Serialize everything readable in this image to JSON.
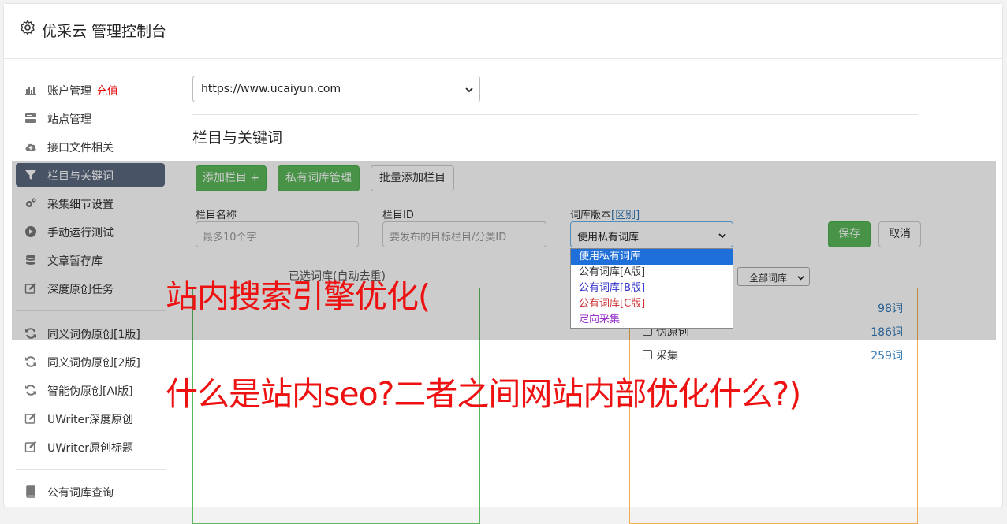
{
  "header": {
    "title": "优采云 管理控制台",
    "icon": "gear-icon"
  },
  "sidebar": {
    "items": [
      {
        "label": "账户管理",
        "badge": "充值",
        "icon": "bar-chart-icon"
      },
      {
        "label": "站点管理",
        "icon": "server-icon"
      },
      {
        "label": "接口文件相关",
        "icon": "cloud-upload-icon"
      },
      {
        "label": "栏目与关键词",
        "icon": "filter-icon",
        "active": true
      },
      {
        "label": "采集细节设置",
        "icon": "cogs-icon"
      },
      {
        "label": "手动运行测试",
        "icon": "play-circle-icon"
      },
      {
        "label": "文章暂存库",
        "icon": "database-icon"
      },
      {
        "label": "深度原创任务",
        "icon": "edit-icon"
      },
      {
        "label": "同义词伪原创[1版]",
        "icon": "refresh-icon"
      },
      {
        "label": "同义词伪原创[2版]",
        "icon": "refresh-icon"
      },
      {
        "label": "智能伪原创[AI版]",
        "icon": "refresh-icon"
      },
      {
        "label": "UWriter深度原创",
        "icon": "edit-icon"
      },
      {
        "label": "UWriter原创标题",
        "icon": "edit-icon"
      },
      {
        "label": "公有词库查询",
        "icon": "book-icon"
      }
    ]
  },
  "main": {
    "site_select": {
      "value": "https://www.ucaiyun.com"
    },
    "section_title": "栏目与关键词",
    "buttons": {
      "add_column": "添加栏目 +",
      "private_lib": "私有词库管理",
      "batch_add": "批量添加栏目",
      "save": "保存",
      "cancel": "取消"
    },
    "form": {
      "column_name_label": "栏目名称",
      "column_name_placeholder": "最多10个字",
      "column_id_label": "栏目ID",
      "column_id_placeholder": "要发布的目标栏目/分类ID",
      "lib_version_label": "词库版本",
      "lib_version_link": "[区别]",
      "lib_version_value": "使用私有词库"
    },
    "dropdown_options": [
      {
        "label": "使用私有词库",
        "color": "#ffffff",
        "selected": true
      },
      {
        "label": "公有词库[A版]",
        "color": "#333333"
      },
      {
        "label": "公有词库[B版]",
        "color": "#3333cc"
      },
      {
        "label": "公有词库[C版]",
        "color": "#cc3333"
      },
      {
        "label": "定向采集",
        "color": "#9933cc"
      }
    ],
    "keyword_label": "已选词库(自动去重)",
    "all_libs_select": "全部词库",
    "libraries": [
      {
        "name": "",
        "count": "98词"
      },
      {
        "name": "伪原创",
        "count": "186词"
      },
      {
        "name": "采集",
        "count": "259词"
      }
    ]
  },
  "overlay_text": {
    "line1": "站内搜索引擎优化(",
    "line2": "什么是站内seo?二者之间网站内部优化什么?)"
  }
}
